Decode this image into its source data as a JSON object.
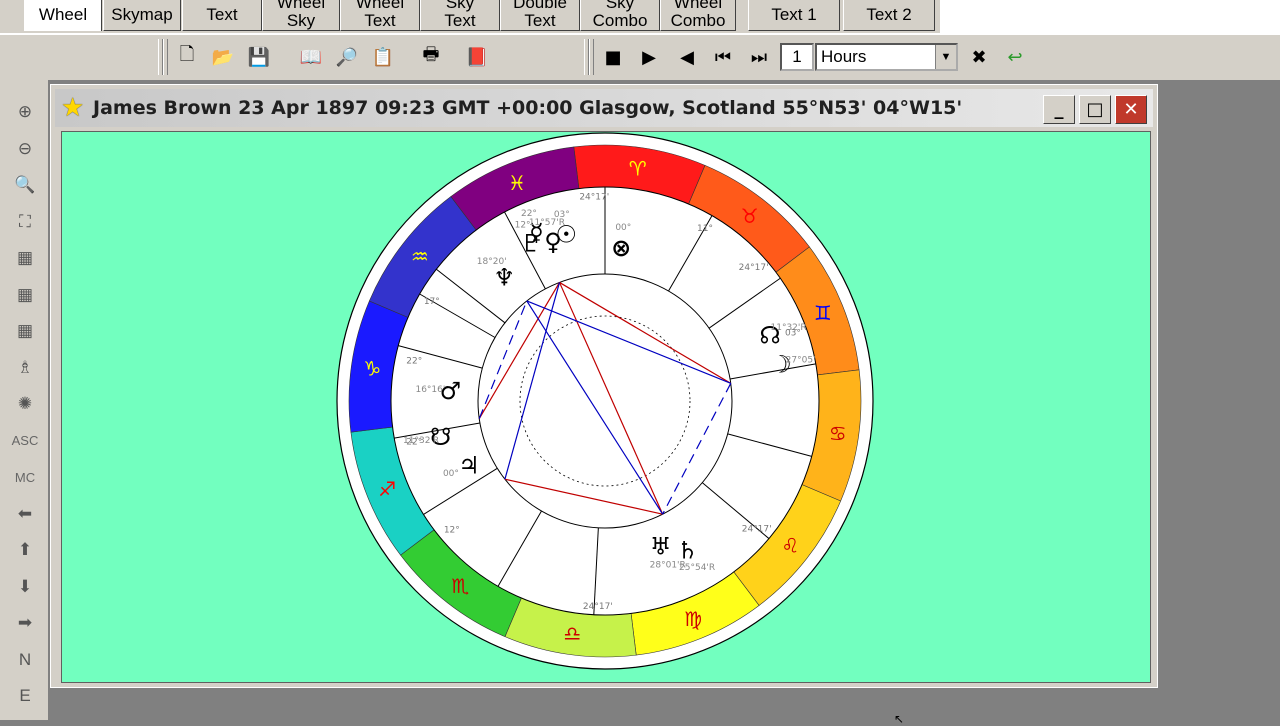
{
  "tabs": [
    {
      "l1": "Wheel",
      "l2": "",
      "selected": true
    },
    {
      "l1": "Skymap",
      "l2": ""
    },
    {
      "l1": "Text",
      "l2": ""
    },
    {
      "l1": "Wheel",
      "l2": "Sky"
    },
    {
      "l1": "Wheel",
      "l2": "Text"
    },
    {
      "l1": "Sky",
      "l2": "Text"
    },
    {
      "l1": "Double",
      "l2": "Text"
    },
    {
      "l1": "Sky",
      "l2": "Combo"
    },
    {
      "l1": "Wheel",
      "l2": "Combo"
    },
    {
      "l1": "Text 1",
      "l2": ""
    },
    {
      "l1": "Text 2",
      "l2": ""
    }
  ],
  "toolbar": {
    "file_icons": [
      "new-file-icon",
      "open-folder-icon",
      "save-disk-icon",
      "open-book-icon",
      "print-preview-icon",
      "clipboard-icon",
      "printer-icon",
      "help-book-icon"
    ],
    "playback_icons": [
      "stop-icon",
      "play-icon",
      "step-back-icon",
      "skip-start-icon",
      "skip-end-icon"
    ],
    "step_value": "1",
    "step_unit": "Hours",
    "extra_icons": [
      "close-x-icon",
      "undo-arrow-icon"
    ]
  },
  "left_toolbar": [
    {
      "name": "zoom-in-icon",
      "label": "⊕"
    },
    {
      "name": "zoom-out-icon",
      "label": "⊖"
    },
    {
      "name": "zoom-box-icon",
      "label": "🔍"
    },
    {
      "name": "binoculars-icon",
      "label": "⛶"
    },
    {
      "name": "grid-1-icon",
      "label": "▦"
    },
    {
      "name": "grid-2-icon",
      "label": "▦"
    },
    {
      "name": "grid-3-icon",
      "label": "▦"
    },
    {
      "name": "chess-piece-icon",
      "label": "♗"
    },
    {
      "name": "sun-wheel-icon",
      "label": "✺"
    },
    {
      "name": "asc-button",
      "label": "ASC"
    },
    {
      "name": "mc-button",
      "label": "MC"
    },
    {
      "name": "arrow-left-icon",
      "label": "⬅"
    },
    {
      "name": "arrow-up-icon",
      "label": "⬆"
    },
    {
      "name": "arrow-down-icon",
      "label": "⬇"
    },
    {
      "name": "arrow-right-icon",
      "label": "➡"
    },
    {
      "name": "north-button",
      "label": "N"
    },
    {
      "name": "east-button",
      "label": "E"
    }
  ],
  "window": {
    "title": "James Brown 23 Apr 1897 09:23 GMT +00:00 Glasgow, Scotland 55°N53' 04°W15'",
    "buttons": [
      "_",
      "□",
      "✕"
    ]
  },
  "chart": {
    "background": "#72ffbf",
    "signs": [
      {
        "glyph": "♈",
        "color": "#ffff00"
      },
      {
        "glyph": "♉",
        "color": "#ff0000"
      },
      {
        "glyph": "♊",
        "color": "#0000ff"
      },
      {
        "glyph": "♋",
        "color": "#cc0000"
      },
      {
        "glyph": "♌",
        "color": "#cc0000"
      },
      {
        "glyph": "♍",
        "color": "#cc0000"
      },
      {
        "glyph": "♎",
        "color": "#cc0000"
      },
      {
        "glyph": "♏",
        "color": "#cc0000"
      },
      {
        "glyph": "♐",
        "color": "#ff0000"
      },
      {
        "glyph": "♑",
        "color": "#ffff00"
      },
      {
        "glyph": "♒",
        "color": "#ffff00"
      },
      {
        "glyph": "♓",
        "color": "#ffff00"
      }
    ],
    "sign_colors": [
      "#ff1a1a",
      "#ff5a1a",
      "#ff8c1a",
      "#ffb31a",
      "#ffd21a",
      "#ffff1a",
      "#c6f24a",
      "#33cc33",
      "#1ad1c4",
      "#1a1aff",
      "#3333cc",
      "#800080"
    ],
    "planets": [
      {
        "name": "sun",
        "glyph": "☉",
        "label": "03°"
      },
      {
        "name": "moon",
        "glyph": "☽",
        "label": "27°05'"
      },
      {
        "name": "mercury",
        "glyph": "☿",
        "label": "22°"
      },
      {
        "name": "venus",
        "glyph": "♀",
        "label": "11°57'R"
      },
      {
        "name": "mars",
        "glyph": "♂",
        "label": "16°16'"
      },
      {
        "name": "jupiter",
        "glyph": "♃",
        "label": "00°"
      },
      {
        "name": "saturn",
        "glyph": "♄",
        "label": "25°54'R"
      },
      {
        "name": "uranus",
        "glyph": "♅",
        "label": "28°01'R"
      },
      {
        "name": "neptune",
        "glyph": "♆",
        "label": "18°20'"
      },
      {
        "name": "pluto",
        "glyph": "♇",
        "label": "12°"
      },
      {
        "name": "north-node",
        "glyph": "☊",
        "label": "11°32'R"
      },
      {
        "name": "south-node",
        "glyph": "☋",
        "label": "11°32'R"
      },
      {
        "name": "part-of-fortune",
        "glyph": "⊗",
        "label": "00°"
      }
    ],
    "house_labels": [
      "24°17'",
      "24°17'",
      "24°17'",
      "24°17'",
      "22°",
      "22°",
      "17°",
      "12°",
      "11°",
      "03°"
    ]
  }
}
